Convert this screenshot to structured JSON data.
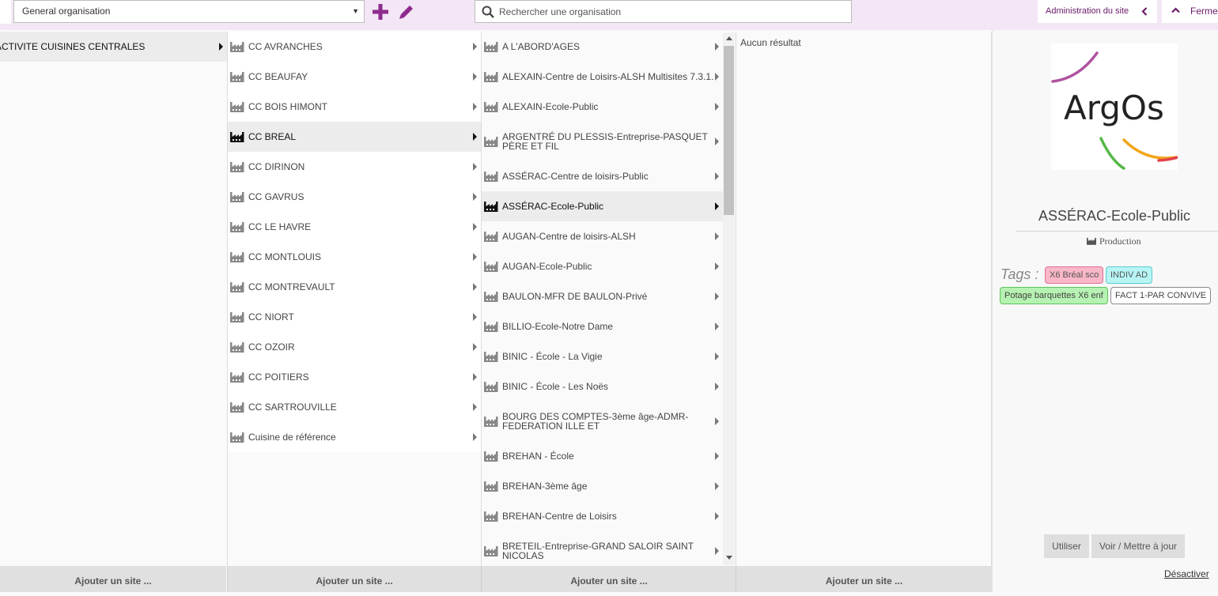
{
  "toolbar": {
    "organisation_select": "General organisation",
    "search_placeholder": "Rechercher une organisation",
    "admin_label": "Administration du site",
    "close_label": "Fermer"
  },
  "columns": [
    {
      "items": [
        {
          "label": "ACTIVITE CUISINES CENTRALES",
          "selected": true,
          "icon": false
        }
      ],
      "footer": "Ajouter un site ..."
    },
    {
      "items": [
        {
          "label": "CC AVRANCHES"
        },
        {
          "label": "CC BEAUFAY"
        },
        {
          "label": "CC BOIS HIMONT"
        },
        {
          "label": "CC BREAL",
          "selected": true
        },
        {
          "label": "CC DIRINON"
        },
        {
          "label": "CC GAVRUS"
        },
        {
          "label": "CC LE HAVRE"
        },
        {
          "label": "CC MONTLOUIS"
        },
        {
          "label": "CC MONTREVAULT"
        },
        {
          "label": "CC NIORT"
        },
        {
          "label": "CC OZOIR"
        },
        {
          "label": "CC POITIERS"
        },
        {
          "label": "CC SARTROUVILLE"
        },
        {
          "label": "Cuisine de référence"
        }
      ],
      "footer": "Ajouter un site ..."
    },
    {
      "items": [
        {
          "label": "A L'ABORD'AGES"
        },
        {
          "label": "ALEXAIN-Centre de Loisirs-ALSH Multisites 7.3.1."
        },
        {
          "label": "ALEXAIN-Ecole-Public"
        },
        {
          "label": "ARGENTRÉ DU PLESSIS-Entreprise-PASQUET PÈRE ET FIL"
        },
        {
          "label": "ASSÉRAC-Centre de loisirs-Public"
        },
        {
          "label": "ASSÉRAC-Ecole-Public",
          "selected": true
        },
        {
          "label": "AUGAN-Centre de loisirs-ALSH"
        },
        {
          "label": "AUGAN-Ecole-Public"
        },
        {
          "label": "BAULON-MFR DE BAULON-Privé"
        },
        {
          "label": "BILLIO-Ecole-Notre Dame"
        },
        {
          "label": "BINIC - École - La Vigie"
        },
        {
          "label": "BINIC - École - Les Noës"
        },
        {
          "label": "BOURG DES COMPTES-3ème âge-ADMR-FEDERATION ILLE ET"
        },
        {
          "label": "BREHAN - École"
        },
        {
          "label": "BREHAN-3ème âge"
        },
        {
          "label": "BREHAN-Centre de Loisirs"
        },
        {
          "label": "BRETEIL-Entreprise-GRAND SALOIR SAINT NICOLAS"
        }
      ],
      "footer": "Ajouter un site ..."
    },
    {
      "empty_text": "Aucun résultat",
      "footer": "Ajouter un site ..."
    }
  ],
  "details": {
    "logo_text": "ArgOs",
    "title": "ASSÉRAC-Ecole-Public",
    "subtitle": "Production",
    "tags_label": "Tags :",
    "tags": [
      {
        "label": "X6 Bréal sco",
        "bg": "#f9b7c8",
        "border": "#e0709a",
        "color": "#555"
      },
      {
        "label": "INDIV AD",
        "bg": "#b7f5f5",
        "border": "#5dc9d0",
        "color": "#555"
      },
      {
        "label": "Potage barquettes X6 enf",
        "bg": "#b6f2b2",
        "border": "#5cc45a",
        "color": "#444"
      },
      {
        "label": "FACT 1-PAR CONVIVE",
        "bg": "#ffffff",
        "border": "#888888",
        "color": "#444"
      }
    ],
    "use_button": "Utiliser",
    "view_update_button": "Voir / Mettre à jour",
    "deactivate_link": "Désactiver"
  },
  "colors": {
    "accent": "#8e2a8e",
    "topbar_bg": "#f3e6f5"
  }
}
